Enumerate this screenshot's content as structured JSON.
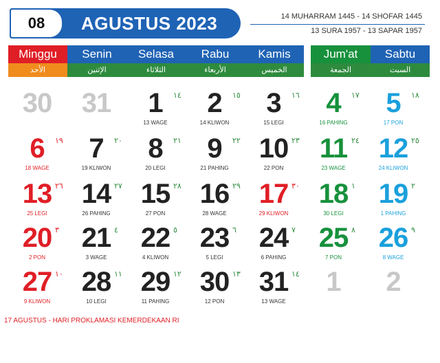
{
  "header": {
    "month_number": "08",
    "month_title": "AGUSTUS 2023",
    "hijri_range": "14 MUHARRAM 1445 - 14 SHOFAR 1445",
    "javanese_range": "13 SURA 1957 - 13 SAPAR 1957"
  },
  "colors": {
    "accent_blue": "#1f63b5",
    "sunday_red": "#e01e26",
    "friday_green": "#17913c",
    "saturday_blue": "#1aa0dc",
    "weekday_dark": "#222222",
    "muted_gray": "#c8c8c8",
    "arabic_green": "#2e8b3e",
    "sunday_orange": "#f08c1e"
  },
  "days": [
    {
      "name": "Minggu",
      "arabic": "الأحد"
    },
    {
      "name": "Senin",
      "arabic": "الإثنين"
    },
    {
      "name": "Selasa",
      "arabic": "الثلاثاء"
    },
    {
      "name": "Rabu",
      "arabic": "الأربعاء"
    },
    {
      "name": "Kamis",
      "arabic": "الخميس"
    },
    {
      "name": "Jum'at",
      "arabic": "الجمعة"
    },
    {
      "name": "Sabtu",
      "arabic": "السبت"
    }
  ],
  "weeks": [
    [
      {
        "d": "30",
        "h": "",
        "p": "",
        "kind": "muted"
      },
      {
        "d": "31",
        "h": "",
        "p": "",
        "kind": "muted"
      },
      {
        "d": "1",
        "h": "١٤",
        "p": "13 WAGE",
        "kind": "normal"
      },
      {
        "d": "2",
        "h": "١٥",
        "p": "14 KLIWON",
        "kind": "normal"
      },
      {
        "d": "3",
        "h": "١٦",
        "p": "15 LEGI",
        "kind": "normal"
      },
      {
        "d": "4",
        "h": "١٧",
        "p": "16 PAHING",
        "kind": "friday"
      },
      {
        "d": "5",
        "h": "١٨",
        "p": "17 PON",
        "kind": "saturday"
      }
    ],
    [
      {
        "d": "6",
        "h": "١٩",
        "p": "18 WAGE",
        "kind": "sunday"
      },
      {
        "d": "7",
        "h": "٢٠",
        "p": "19 KLIWON",
        "kind": "normal"
      },
      {
        "d": "8",
        "h": "٢١",
        "p": "20 LEGI",
        "kind": "normal"
      },
      {
        "d": "9",
        "h": "٢٢",
        "p": "21 PAHING",
        "kind": "normal"
      },
      {
        "d": "10",
        "h": "٢٣",
        "p": "22 PON",
        "kind": "normal"
      },
      {
        "d": "11",
        "h": "٢٤",
        "p": "23 WAGE",
        "kind": "friday"
      },
      {
        "d": "12",
        "h": "٢٥",
        "p": "24 KLIWON",
        "kind": "saturday"
      }
    ],
    [
      {
        "d": "13",
        "h": "٢٦",
        "p": "25 LEGI",
        "kind": "sunday"
      },
      {
        "d": "14",
        "h": "٢٧",
        "p": "26 PAHING",
        "kind": "normal"
      },
      {
        "d": "15",
        "h": "٢٨",
        "p": "27 PON",
        "kind": "normal"
      },
      {
        "d": "16",
        "h": "٢٩",
        "p": "28 WAGE",
        "kind": "normal"
      },
      {
        "d": "17",
        "h": "٣٠",
        "p": "29 KLIWON",
        "kind": "holiday"
      },
      {
        "d": "18",
        "h": "١",
        "p": "30 LEGI",
        "kind": "friday"
      },
      {
        "d": "19",
        "h": "٢",
        "p": "1 PAHING",
        "kind": "saturday"
      }
    ],
    [
      {
        "d": "20",
        "h": "٣",
        "p": "2 PON",
        "kind": "sunday"
      },
      {
        "d": "21",
        "h": "٤",
        "p": "3 WAGE",
        "kind": "normal"
      },
      {
        "d": "22",
        "h": "٥",
        "p": "4 KLIWON",
        "kind": "normal"
      },
      {
        "d": "23",
        "h": "٦",
        "p": "5 LEGI",
        "kind": "normal"
      },
      {
        "d": "24",
        "h": "٧",
        "p": "6 PAHING",
        "kind": "normal"
      },
      {
        "d": "25",
        "h": "٨",
        "p": "7 PON",
        "kind": "friday"
      },
      {
        "d": "26",
        "h": "٩",
        "p": "8 WAGE",
        "kind": "saturday"
      }
    ],
    [
      {
        "d": "27",
        "h": "١٠",
        "p": "9 KLIWON",
        "kind": "sunday"
      },
      {
        "d": "28",
        "h": "١١",
        "p": "10 LEGI",
        "kind": "normal"
      },
      {
        "d": "29",
        "h": "١٢",
        "p": "11 PAHING",
        "kind": "normal"
      },
      {
        "d": "30",
        "h": "١٣",
        "p": "12 PON",
        "kind": "normal"
      },
      {
        "d": "31",
        "h": "١٤",
        "p": "13 WAGE",
        "kind": "normal"
      },
      {
        "d": "1",
        "h": "",
        "p": "",
        "kind": "muted"
      },
      {
        "d": "2",
        "h": "",
        "p": "",
        "kind": "muted"
      }
    ]
  ],
  "footnote": "17 AGUSTUS - HARI PROKLAMASI KEMERDEKAAN RI"
}
